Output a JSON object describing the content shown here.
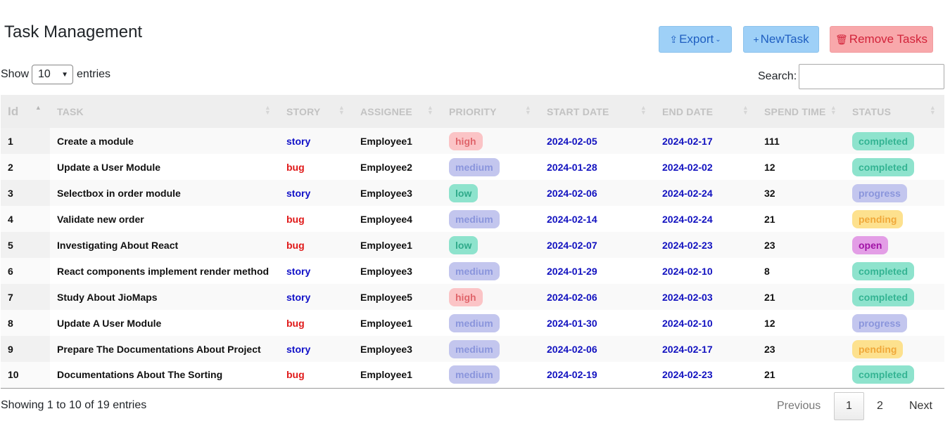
{
  "title": "Task Management",
  "toolbar": {
    "export_label": "Export",
    "new_label": "NewTask",
    "remove_label": "Remove Tasks"
  },
  "length_menu": {
    "prefix": "Show",
    "value": "10",
    "suffix": "entries"
  },
  "search": {
    "label": "Search:",
    "value": ""
  },
  "columns": [
    "Id",
    "TASK",
    "STORY",
    "ASSIGNEE",
    "PRIORITY",
    "START DATE",
    "END DATE",
    "SPEND TIME",
    "STATUS"
  ],
  "rows": [
    {
      "id": "1",
      "task": "Create a module",
      "story": "story",
      "assignee": "Employee1",
      "priority": "high",
      "start": "2024-02-05",
      "end": "2024-02-17",
      "spend": "111",
      "status": "completed"
    },
    {
      "id": "2",
      "task": "Update a User Module",
      "story": "bug",
      "assignee": "Employee2",
      "priority": "medium",
      "start": "2024-01-28",
      "end": "2024-02-02",
      "spend": "12",
      "status": "completed"
    },
    {
      "id": "3",
      "task": "Selectbox in order module",
      "story": "story",
      "assignee": "Employee3",
      "priority": "low",
      "start": "2024-02-06",
      "end": "2024-02-24",
      "spend": "32",
      "status": "progress"
    },
    {
      "id": "4",
      "task": "Validate new order",
      "story": "bug",
      "assignee": "Employee4",
      "priority": "medium",
      "start": "2024-02-14",
      "end": "2024-02-24",
      "spend": "21",
      "status": "pending"
    },
    {
      "id": "5",
      "task": "Investigating About React",
      "story": "bug",
      "assignee": "Employee1",
      "priority": "low",
      "start": "2024-02-07",
      "end": "2024-02-23",
      "spend": "23",
      "status": "open"
    },
    {
      "id": "6",
      "task": "React components implement render method",
      "story": "story",
      "assignee": "Employee3",
      "priority": "medium",
      "start": "2024-01-29",
      "end": "2024-02-10",
      "spend": "8",
      "status": "completed"
    },
    {
      "id": "7",
      "task": "Study About JioMaps",
      "story": "story",
      "assignee": "Employee5",
      "priority": "high",
      "start": "2024-02-06",
      "end": "2024-02-03",
      "spend": "21",
      "status": "completed"
    },
    {
      "id": "8",
      "task": "Update A User Module",
      "story": "bug",
      "assignee": "Employee1",
      "priority": "medium",
      "start": "2024-01-30",
      "end": "2024-02-10",
      "spend": "12",
      "status": "progress"
    },
    {
      "id": "9",
      "task": "Prepare The Documentations About Project",
      "story": "story",
      "assignee": "Employee3",
      "priority": "medium",
      "start": "2024-02-06",
      "end": "2024-02-17",
      "spend": "23",
      "status": "pending"
    },
    {
      "id": "10",
      "task": "Documentations About The Sorting",
      "story": "bug",
      "assignee": "Employee1",
      "priority": "medium",
      "start": "2024-02-19",
      "end": "2024-02-23",
      "spend": "21",
      "status": "completed"
    }
  ],
  "info": "Showing 1 to 10 of 19 entries",
  "pagination": {
    "previous": "Previous",
    "page1": "1",
    "page2": "2",
    "next": "Next"
  },
  "colors": {
    "primary_button": "#9ed0f7",
    "danger_button": "#f8a8ab",
    "story": "#1010c8",
    "bug": "#e01818",
    "date": "#1212c0"
  }
}
